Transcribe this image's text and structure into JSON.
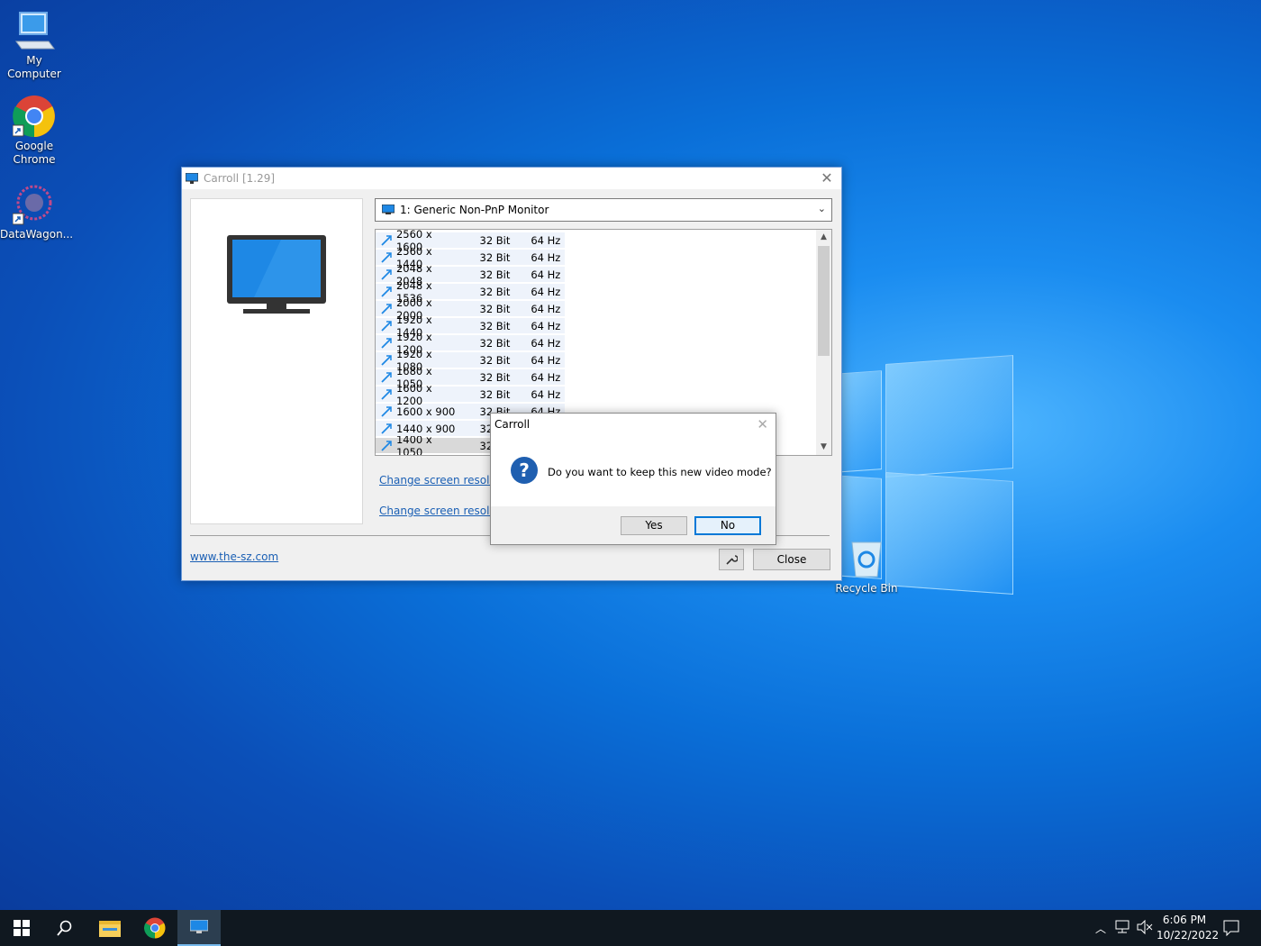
{
  "desktop": {
    "icons": [
      {
        "label_line1": "My",
        "label_line2": "Computer"
      },
      {
        "label_line1": "Google",
        "label_line2": "Chrome"
      },
      {
        "label_line1": "DataWagon...",
        "label_line2": ""
      },
      {
        "label_line1": "Recycle Bin",
        "label_line2": ""
      }
    ]
  },
  "window": {
    "title": "Carroll [1.29]",
    "monitor_select": "1: Generic Non-PnP Monitor",
    "modes": [
      {
        "res": "2560 x 1600",
        "depth": "32 Bit",
        "freq": "64 Hz"
      },
      {
        "res": "2560 x 1440",
        "depth": "32 Bit",
        "freq": "64 Hz"
      },
      {
        "res": "2048 x 2048",
        "depth": "32 Bit",
        "freq": "64 Hz"
      },
      {
        "res": "2048 x 1536",
        "depth": "32 Bit",
        "freq": "64 Hz"
      },
      {
        "res": "2000 x 2000",
        "depth": "32 Bit",
        "freq": "64 Hz"
      },
      {
        "res": "1920 x 1440",
        "depth": "32 Bit",
        "freq": "64 Hz"
      },
      {
        "res": "1920 x 1200",
        "depth": "32 Bit",
        "freq": "64 Hz"
      },
      {
        "res": "1920 x 1080",
        "depth": "32 Bit",
        "freq": "64 Hz"
      },
      {
        "res": "1680 x 1050",
        "depth": "32 Bit",
        "freq": "64 Hz"
      },
      {
        "res": "1600 x 1200",
        "depth": "32 Bit",
        "freq": "64 Hz"
      },
      {
        "res": "1600 x 900",
        "depth": "32 Bit",
        "freq": "64 Hz"
      },
      {
        "res": "1440 x 900",
        "depth": "32",
        "freq": ""
      },
      {
        "res": "1400 x 1050",
        "depth": "32",
        "freq": ""
      }
    ],
    "link1": "Change screen resolutic",
    "link2": "Change screen resolutic",
    "website": "www.the-sz.com",
    "close_label": "Close"
  },
  "dialog": {
    "title": "Carroll",
    "message": "Do you want to keep this new video mode?",
    "yes_label": "Yes",
    "no_label": "No"
  },
  "taskbar": {
    "time": "6:06 PM",
    "date": "10/22/2022"
  },
  "colors": {
    "accent": "#1a5fb4",
    "taskbar": "#101820",
    "selected_row": "#d9d9d9"
  }
}
